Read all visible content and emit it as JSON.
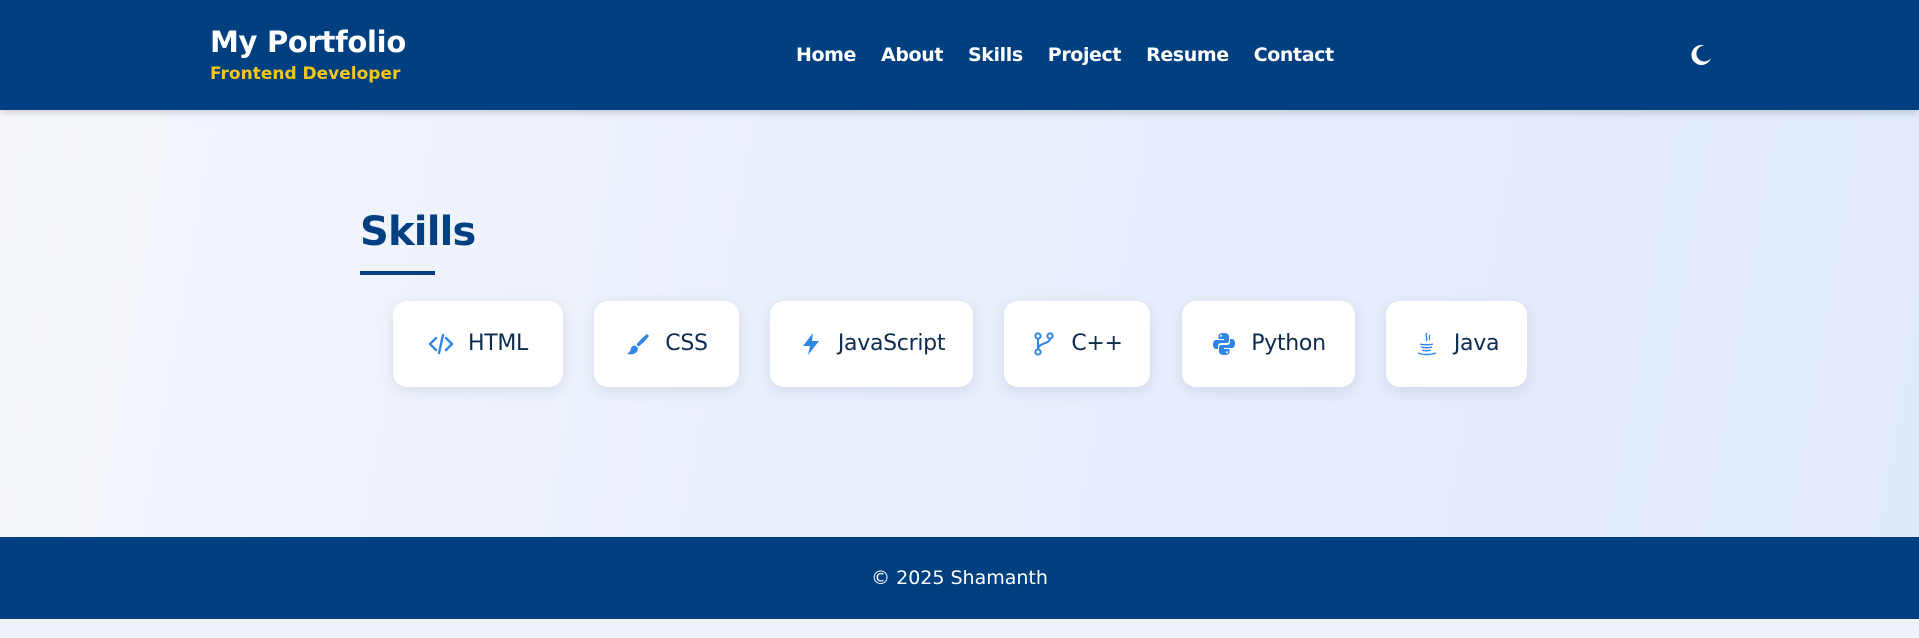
{
  "brand": {
    "title": "My Portfolio",
    "subtitle": "Frontend Developer"
  },
  "nav": {
    "links": [
      {
        "label": "Home"
      },
      {
        "label": "About"
      },
      {
        "label": "Skills"
      },
      {
        "label": "Project"
      },
      {
        "label": "Resume"
      },
      {
        "label": "Contact"
      }
    ],
    "theme_icon": "moon-icon"
  },
  "skills_section": {
    "title": "Skills",
    "items": [
      {
        "label": "HTML",
        "icon": "code-icon"
      },
      {
        "label": "CSS",
        "icon": "paintbrush-icon"
      },
      {
        "label": "JavaScript",
        "icon": "bolt-icon"
      },
      {
        "label": "C++",
        "icon": "git-branch-icon"
      },
      {
        "label": "Python",
        "icon": "python-icon"
      },
      {
        "label": "Java",
        "icon": "java-cup-icon"
      }
    ]
  },
  "footer": {
    "text": "© 2025 Shamanth"
  },
  "colors": {
    "primary": "#003f80",
    "accent": "#f5c518",
    "icon": "#2f86e6",
    "card_text": "#0d2a4f"
  }
}
